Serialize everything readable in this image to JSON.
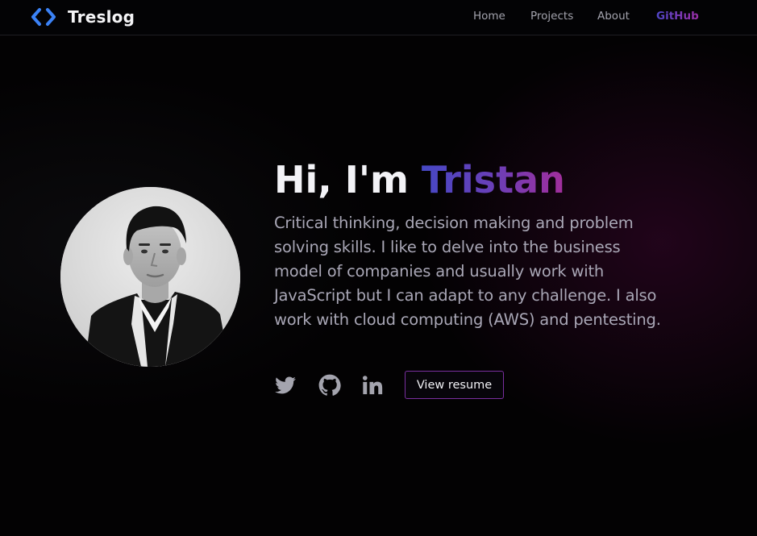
{
  "brand": {
    "name": "Treslog",
    "icon": "code-brackets-icon",
    "color": "#3b82f6"
  },
  "nav": {
    "links": [
      {
        "label": "Home"
      },
      {
        "label": "Projects"
      },
      {
        "label": "About"
      },
      {
        "label": "GitHub"
      }
    ]
  },
  "hero": {
    "greeting": "Hi, I'm ",
    "name": "Tristan",
    "bio": "Critical thinking, decision making and problem solving skills. I like to delve into the business model of companies and usually work with JavaScript but I can adapt to any challenge. I also work with cloud computing (AWS) and pentesting.",
    "social": [
      {
        "icon": "twitter-icon"
      },
      {
        "icon": "github-icon"
      },
      {
        "icon": "linkedin-icon"
      }
    ],
    "resume_label": "View resume"
  },
  "colors": {
    "background": "#030203",
    "accent_start": "#4648c4",
    "accent_end": "#a22e9b",
    "text_muted": "#a9a7b6"
  }
}
